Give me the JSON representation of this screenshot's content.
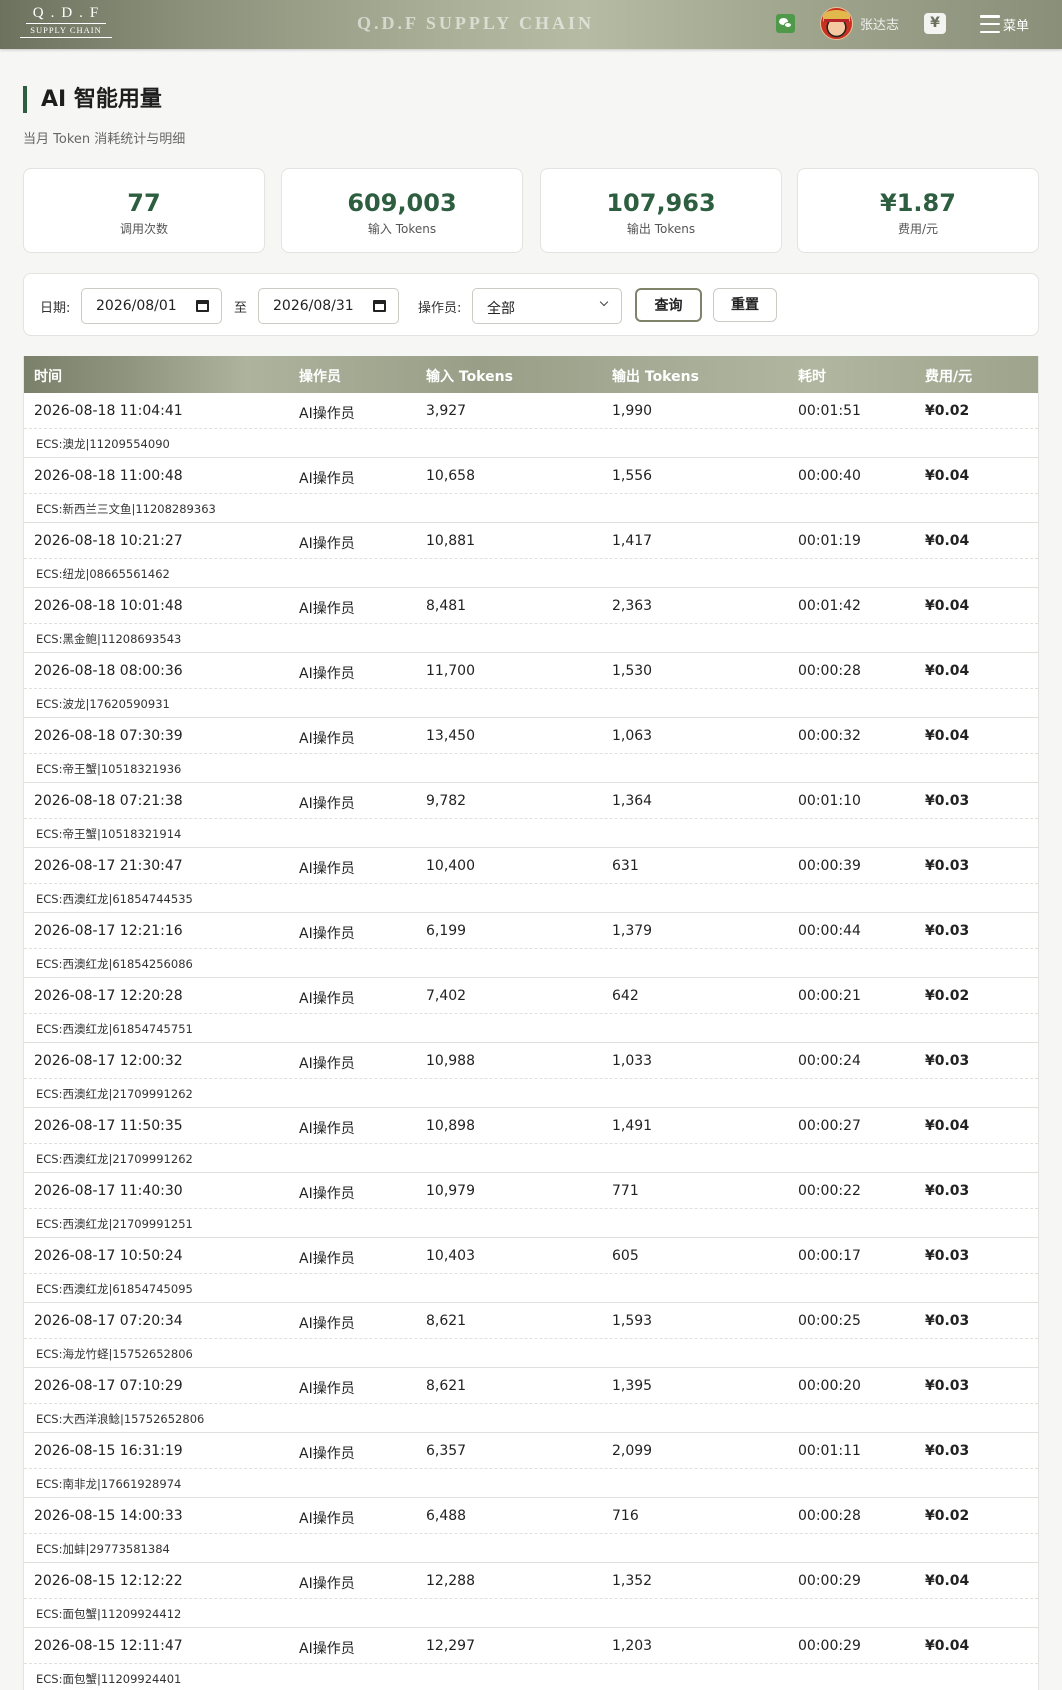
{
  "header": {
    "logo_top": "Q.D.F",
    "logo_sub": "SUPPLY CHAIN",
    "brand": "Q.D.F SUPPLY CHAIN",
    "user_name": "张达志",
    "yen_symbol": "¥",
    "menu_label": "菜单"
  },
  "page": {
    "title": "AI 智能用量",
    "subtitle": "当月 Token 消耗统计与明细"
  },
  "stats": [
    {
      "value": "77",
      "label": "调用次数"
    },
    {
      "value": "609,003",
      "label": "输入 Tokens"
    },
    {
      "value": "107,963",
      "label": "输出 Tokens"
    },
    {
      "value": "¥1.87",
      "label": "费用/元"
    }
  ],
  "filter": {
    "date_label": "日期:",
    "start_date": "2026/08/01",
    "to_label": "至",
    "end_date": "2026/08/31",
    "operator_label": "操作员:",
    "operator_value": "全部",
    "query_label": "查询",
    "reset_label": "重置"
  },
  "table": {
    "headers": [
      "时间",
      "操作员",
      "输入 Tokens",
      "输出 Tokens",
      "耗时",
      "费用/元"
    ],
    "rows": [
      {
        "time": "2026-08-18 11:04:41",
        "operator": "AI操作员",
        "input": "3,927",
        "output": "1,990",
        "duration": "00:01:51",
        "fee": "¥0.02",
        "ecs": "ECS:澳龙|11209554090"
      },
      {
        "time": "2026-08-18 11:00:48",
        "operator": "AI操作员",
        "input": "10,658",
        "output": "1,556",
        "duration": "00:00:40",
        "fee": "¥0.04",
        "ecs": "ECS:新西兰三文鱼|11208289363"
      },
      {
        "time": "2026-08-18 10:21:27",
        "operator": "AI操作员",
        "input": "10,881",
        "output": "1,417",
        "duration": "00:01:19",
        "fee": "¥0.04",
        "ecs": "ECS:纽龙|08665561462"
      },
      {
        "time": "2026-08-18 10:01:48",
        "operator": "AI操作员",
        "input": "8,481",
        "output": "2,363",
        "duration": "00:01:42",
        "fee": "¥0.04",
        "ecs": "ECS:黑金鲍|11208693543"
      },
      {
        "time": "2026-08-18 08:00:36",
        "operator": "AI操作员",
        "input": "11,700",
        "output": "1,530",
        "duration": "00:00:28",
        "fee": "¥0.04",
        "ecs": "ECS:波龙|17620590931"
      },
      {
        "time": "2026-08-18 07:30:39",
        "operator": "AI操作员",
        "input": "13,450",
        "output": "1,063",
        "duration": "00:00:32",
        "fee": "¥0.04",
        "ecs": "ECS:帝王蟹|10518321936"
      },
      {
        "time": "2026-08-18 07:21:38",
        "operator": "AI操作员",
        "input": "9,782",
        "output": "1,364",
        "duration": "00:01:10",
        "fee": "¥0.03",
        "ecs": "ECS:帝王蟹|10518321914"
      },
      {
        "time": "2026-08-17 21:30:47",
        "operator": "AI操作员",
        "input": "10,400",
        "output": "631",
        "duration": "00:00:39",
        "fee": "¥0.03",
        "ecs": "ECS:西澳红龙|61854744535"
      },
      {
        "time": "2026-08-17 12:21:16",
        "operator": "AI操作员",
        "input": "6,199",
        "output": "1,379",
        "duration": "00:00:44",
        "fee": "¥0.03",
        "ecs": "ECS:西澳红龙|61854256086"
      },
      {
        "time": "2026-08-17 12:20:28",
        "operator": "AI操作员",
        "input": "7,402",
        "output": "642",
        "duration": "00:00:21",
        "fee": "¥0.02",
        "ecs": "ECS:西澳红龙|61854745751"
      },
      {
        "time": "2026-08-17 12:00:32",
        "operator": "AI操作员",
        "input": "10,988",
        "output": "1,033",
        "duration": "00:00:24",
        "fee": "¥0.03",
        "ecs": "ECS:西澳红龙|21709991262"
      },
      {
        "time": "2026-08-17 11:50:35",
        "operator": "AI操作员",
        "input": "10,898",
        "output": "1,491",
        "duration": "00:00:27",
        "fee": "¥0.04",
        "ecs": "ECS:西澳红龙|21709991262"
      },
      {
        "time": "2026-08-17 11:40:30",
        "operator": "AI操作员",
        "input": "10,979",
        "output": "771",
        "duration": "00:00:22",
        "fee": "¥0.03",
        "ecs": "ECS:西澳红龙|21709991251"
      },
      {
        "time": "2026-08-17 10:50:24",
        "operator": "AI操作员",
        "input": "10,403",
        "output": "605",
        "duration": "00:00:17",
        "fee": "¥0.03",
        "ecs": "ECS:西澳红龙|61854745095"
      },
      {
        "time": "2026-08-17 07:20:34",
        "operator": "AI操作员",
        "input": "8,621",
        "output": "1,593",
        "duration": "00:00:25",
        "fee": "¥0.03",
        "ecs": "ECS:海龙竹蛏|15752652806"
      },
      {
        "time": "2026-08-17 07:10:29",
        "operator": "AI操作员",
        "input": "8,621",
        "output": "1,395",
        "duration": "00:00:20",
        "fee": "¥0.03",
        "ecs": "ECS:大西洋浪鲶|15752652806"
      },
      {
        "time": "2026-08-15 16:31:19",
        "operator": "AI操作员",
        "input": "6,357",
        "output": "2,099",
        "duration": "00:01:11",
        "fee": "¥0.03",
        "ecs": "ECS:南非龙|17661928974"
      },
      {
        "time": "2026-08-15 14:00:33",
        "operator": "AI操作员",
        "input": "6,488",
        "output": "716",
        "duration": "00:00:28",
        "fee": "¥0.02",
        "ecs": "ECS:加蚌|29773581384"
      },
      {
        "time": "2026-08-15 12:12:22",
        "operator": "AI操作员",
        "input": "12,288",
        "output": "1,352",
        "duration": "00:00:29",
        "fee": "¥0.04",
        "ecs": "ECS:面包蟹|11209924412"
      },
      {
        "time": "2026-08-15 12:11:47",
        "operator": "AI操作员",
        "input": "12,297",
        "output": "1,203",
        "duration": "00:00:29",
        "fee": "¥0.04",
        "ecs": "ECS:面包蟹|11209924401"
      }
    ]
  }
}
